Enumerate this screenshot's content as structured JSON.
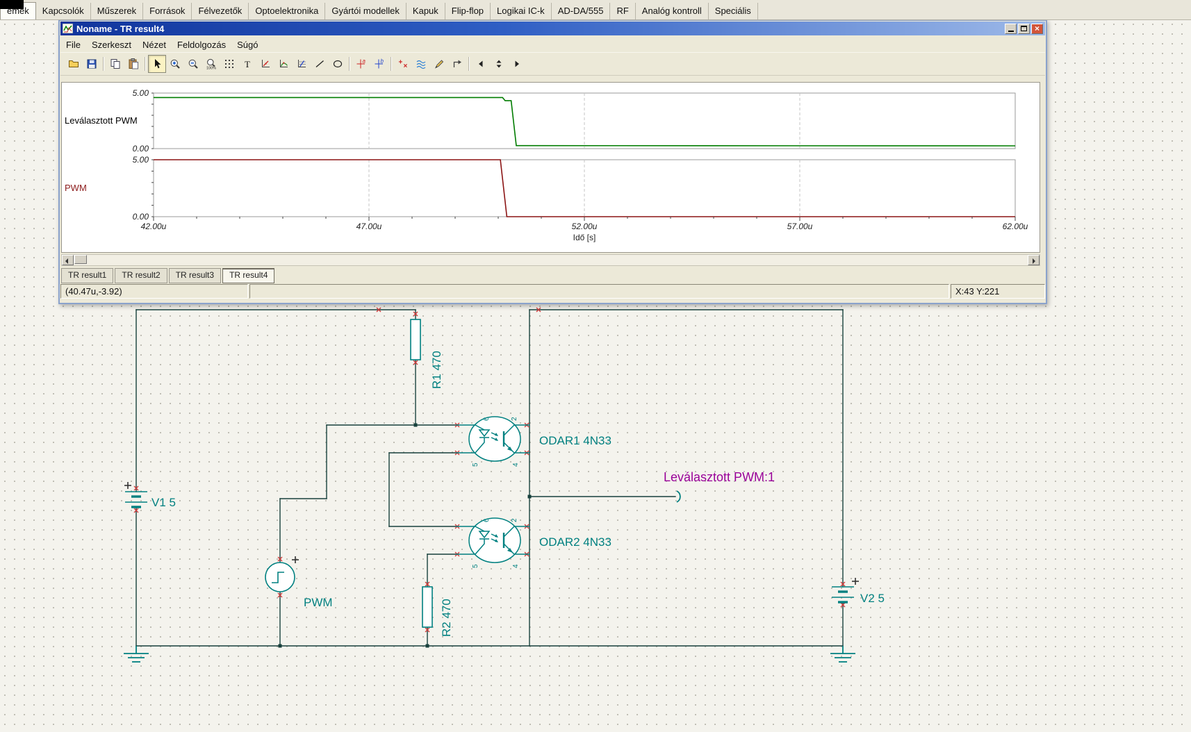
{
  "category_tabs": {
    "items": [
      "emek",
      "Kapcsolók",
      "Műszerek",
      "Források",
      "Félvezetők",
      "Optoelektronika",
      "Gyártói modellek",
      "Kapuk",
      "Flip-flop",
      "Logikai IC-k",
      "AD-DA/555",
      "RF",
      "Analóg kontroll",
      "Speciális"
    ],
    "active_index": 0
  },
  "window": {
    "title": "Noname - TR result4",
    "menu_items": [
      "File",
      "Szerkeszt",
      "Nézet",
      "Feldolgozás",
      "Súgó"
    ],
    "toolbar_buttons": [
      {
        "name": "open-button",
        "icon": "open-icon"
      },
      {
        "name": "save-button",
        "icon": "save-icon"
      },
      {
        "name": "separator"
      },
      {
        "name": "copy-button",
        "icon": "copy-icon"
      },
      {
        "name": "paste-button",
        "icon": "paste-icon"
      },
      {
        "name": "separator"
      },
      {
        "name": "select-tool-button",
        "icon": "cursor-icon",
        "active": true
      },
      {
        "name": "zoom-in-button",
        "icon": "zoom-in-icon"
      },
      {
        "name": "zoom-out-button",
        "icon": "zoom-out-icon"
      },
      {
        "name": "zoom-100-button",
        "icon": "zoom-100-icon"
      },
      {
        "name": "grid-toggle-button",
        "icon": "grid-icon"
      },
      {
        "name": "text-tool-button",
        "icon": "text-icon"
      },
      {
        "name": "axis-tool-a-button",
        "icon": "axis-a-icon"
      },
      {
        "name": "axis-tool-b-button",
        "icon": "axis-b-icon"
      },
      {
        "name": "axis-tool-c-button",
        "icon": "axis-c-icon"
      },
      {
        "name": "line-tool-button",
        "icon": "line-icon"
      },
      {
        "name": "ellipse-tool-button",
        "icon": "ellipse-icon"
      },
      {
        "name": "separator"
      },
      {
        "name": "cursor-a-button",
        "icon": "cursor-a-icon"
      },
      {
        "name": "cursor-b-button",
        "icon": "cursor-b-icon"
      },
      {
        "name": "separator"
      },
      {
        "name": "marker-button",
        "icon": "plus-minus-icon"
      },
      {
        "name": "interpolate-button",
        "icon": "waves-icon"
      },
      {
        "name": "pen-button",
        "icon": "pen-icon"
      },
      {
        "name": "corner-arrow-button",
        "icon": "corner-arrow-icon"
      },
      {
        "name": "separator"
      },
      {
        "name": "prev-page-button",
        "icon": "arrow-left-icon"
      },
      {
        "name": "page-spinner-button",
        "icon": "spinner-icon"
      },
      {
        "name": "next-page-button",
        "icon": "arrow-right-icon"
      }
    ],
    "result_tabs": {
      "items": [
        "TR result1",
        "TR result2",
        "TR result3",
        "TR result4"
      ],
      "active_index": 3
    },
    "status_left": "(40.47u,-3.92)",
    "status_right": "X:43 Y:221"
  },
  "chart_data": {
    "type": "line",
    "xlabel": "Idő [s]",
    "x_range": [
      42,
      62
    ],
    "x_unit": "u",
    "x_ticks": [
      {
        "v": 42,
        "label": "42.00u"
      },
      {
        "v": 47,
        "label": "47.00u"
      },
      {
        "v": 52,
        "label": "52.00u"
      },
      {
        "v": 57,
        "label": "57.00u"
      },
      {
        "v": 62,
        "label": "62.00u"
      }
    ],
    "grid": "dashed-vertical",
    "legend_position": "left-of-each-panel",
    "panels": [
      {
        "label": "Leválasztott PWM",
        "label_color": "#000000",
        "trace_color": "#007c00",
        "y_range": [
          0,
          5
        ],
        "y_ticks": [
          {
            "v": 5,
            "label": "5.00"
          },
          {
            "v": 0,
            "label": "0.00"
          }
        ],
        "points": [
          [
            42,
            4.6
          ],
          [
            50.1,
            4.6
          ],
          [
            50.16,
            4.32
          ],
          [
            50.3,
            4.32
          ],
          [
            50.42,
            0.27
          ],
          [
            62,
            0.25
          ]
        ]
      },
      {
        "label": "PWM",
        "label_color": "#8b1a1a",
        "trace_color": "#8b1414",
        "y_range": [
          0,
          5
        ],
        "y_ticks": [
          {
            "v": 5,
            "label": "5.00"
          },
          {
            "v": 0,
            "label": "0.00"
          }
        ],
        "points": [
          [
            42,
            5
          ],
          [
            50.05,
            5
          ],
          [
            50.2,
            0
          ],
          [
            62,
            0
          ]
        ]
      }
    ]
  },
  "schematic": {
    "wire_color": "#17403c",
    "symbol_color": "#008080",
    "pin_marker_color": "#d03a3a",
    "components": {
      "v1": {
        "label": "V1 5",
        "plus": "+"
      },
      "r1": {
        "label": "R1 470"
      },
      "pwm": {
        "label": "PWM",
        "plus": "+"
      },
      "r2": {
        "label": "R2 470"
      },
      "odar1": {
        "label": "ODAR1 4N33",
        "pin_top_left": "6",
        "pin_top_right": "2",
        "pin_bottom_left": "5",
        "pin_bottom_right": "4"
      },
      "odar2": {
        "label": "ODAR2 4N33",
        "pin_top_left": "6",
        "pin_top_right": "2",
        "pin_bottom_left": "5",
        "pin_bottom_right": "4"
      },
      "output": {
        "label": "Leválasztott PWM:1",
        "label_color": "#990099"
      },
      "v2": {
        "label": "V2 5",
        "plus": "+"
      }
    }
  }
}
